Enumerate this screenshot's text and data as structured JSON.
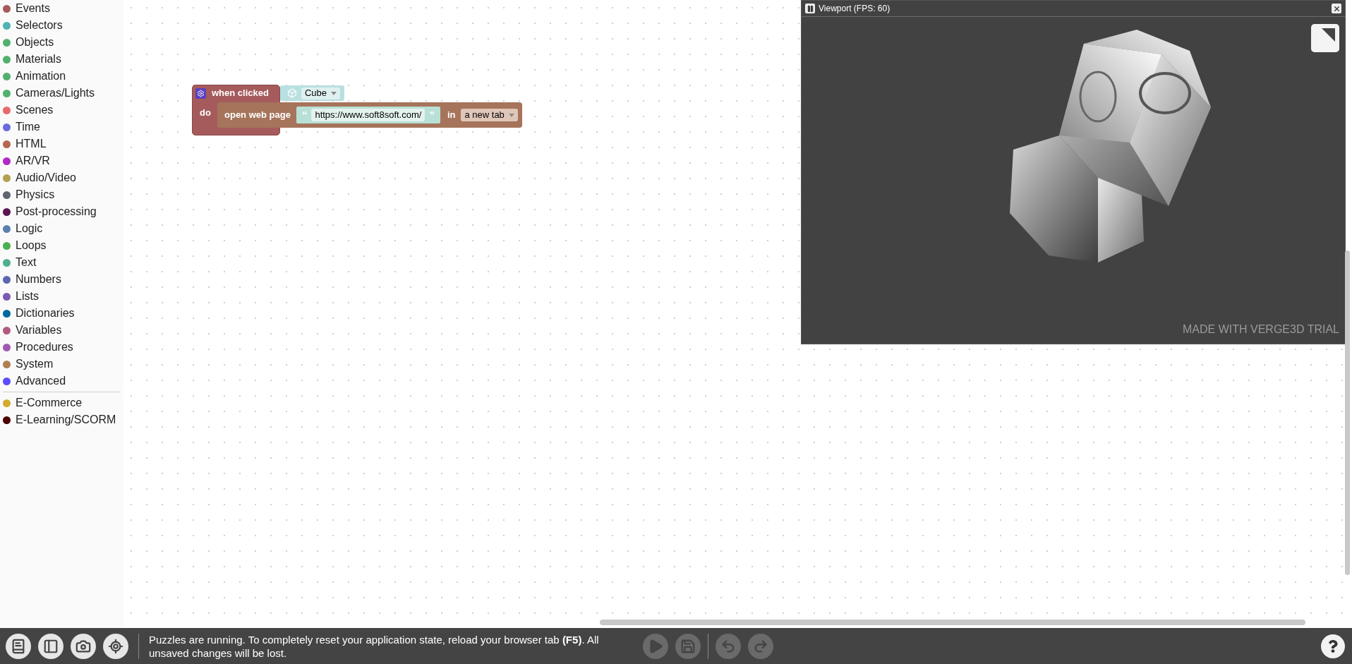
{
  "sidebar": {
    "categories": [
      {
        "label": "Events",
        "color": "#a55b5b"
      },
      {
        "label": "Selectors",
        "color": "#4fb3b3"
      },
      {
        "label": "Objects",
        "color": "#52b06e"
      },
      {
        "label": "Materials",
        "color": "#52b06e"
      },
      {
        "label": "Animation",
        "color": "#52b06e"
      },
      {
        "label": "Cameras/Lights",
        "color": "#52b06e"
      },
      {
        "label": "Scenes",
        "color": "#e86a6a"
      },
      {
        "label": "Time",
        "color": "#6a6ae0"
      },
      {
        "label": "HTML",
        "color": "#b3694f"
      },
      {
        "label": "AR/VR",
        "color": "#b02ac8"
      },
      {
        "label": "Audio/Video",
        "color": "#b3a050"
      },
      {
        "label": "Physics",
        "color": "#5e6470"
      },
      {
        "label": "Post-processing",
        "color": "#5a1650"
      },
      {
        "label": "Logic",
        "color": "#5b80b0"
      },
      {
        "label": "Loops",
        "color": "#4cb050"
      },
      {
        "label": "Text",
        "color": "#50b08c"
      },
      {
        "label": "Numbers",
        "color": "#5b67b0"
      },
      {
        "label": "Lists",
        "color": "#7a5bb0"
      },
      {
        "label": "Dictionaries",
        "color": "#0069a0"
      },
      {
        "label": "Variables",
        "color": "#b05b80"
      },
      {
        "label": "Procedures",
        "color": "#a05bb0"
      },
      {
        "label": "System",
        "color": "#b07f50"
      },
      {
        "label": "Advanced",
        "color": "#5a4cff"
      }
    ],
    "extra_categories": [
      {
        "label": "E-Commerce",
        "color": "#d4ab2d"
      },
      {
        "label": "E-Learning/SCORM",
        "color": "#4a0000"
      }
    ]
  },
  "event_block": {
    "label": "when clicked",
    "object": "Cube",
    "do_label": "do",
    "statement": {
      "label": "open web page",
      "open_quote": "“",
      "url": "https://www.soft8soft.com/",
      "close_quote": "”",
      "in_label": "in",
      "target": "a new tab"
    }
  },
  "viewport": {
    "title": "Viewport (FPS: 60)",
    "watermark": "MADE WITH VERGE3D TRIAL"
  },
  "status_bar": {
    "tools": [
      {
        "kind": "book"
      },
      {
        "kind": "panel"
      },
      {
        "kind": "camera"
      },
      {
        "kind": "target"
      }
    ],
    "message": "Puzzles are running. To completely reset your application state, reload your browser tab **(F5)**. All unsaved changes will be lost.",
    "actions": [
      {
        "kind": "play",
        "disabled": true
      },
      {
        "kind": "save",
        "disabled": true
      },
      {
        "kind": "undo",
        "disabled": true
      },
      {
        "kind": "redo",
        "disabled": true
      }
    ]
  }
}
